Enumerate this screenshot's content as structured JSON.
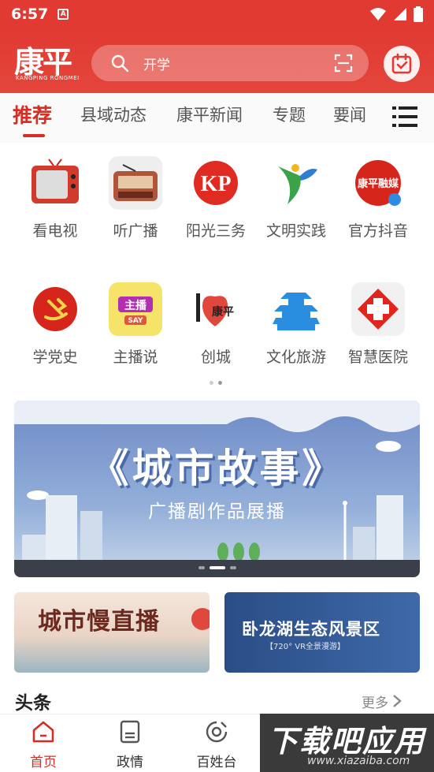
{
  "status": {
    "time": "6:57",
    "notif_letter": "A"
  },
  "header": {
    "logo_text": "康平",
    "logo_subtext": "KANGPING RONGMEI",
    "search_placeholder": "开学"
  },
  "tabs": [
    {
      "label": "推荐",
      "active": true
    },
    {
      "label": "县域动态"
    },
    {
      "label": "康平新闻"
    },
    {
      "label": "专题"
    },
    {
      "label": "要闻"
    }
  ],
  "grid_row1": [
    {
      "label": "看电视",
      "icon": "tv-icon"
    },
    {
      "label": "听广播",
      "icon": "radio-icon"
    },
    {
      "label": "阳光三务",
      "icon": "kp-logo-icon"
    },
    {
      "label": "文明实践",
      "icon": "civilization-icon"
    },
    {
      "label": "官方抖音",
      "icon": "douyin-icon",
      "badge_text": "康平融媒"
    }
  ],
  "grid_row2": [
    {
      "label": "学党史",
      "icon": "party-emblem-icon"
    },
    {
      "label": "主播说",
      "icon": "anchor-say-icon",
      "badge_text": "主播",
      "badge_sub": "SAY"
    },
    {
      "label": "创城",
      "icon": "love-kangping-icon",
      "badge_text": "康平"
    },
    {
      "label": "文化旅游",
      "icon": "pavilion-icon"
    },
    {
      "label": "智慧医院",
      "icon": "hospital-cross-icon"
    }
  ],
  "banner": {
    "title": "《城市故事》",
    "subtitle": "广播剧作品展播"
  },
  "cards": [
    {
      "title": "城市慢直播"
    },
    {
      "title": "卧龙湖生态风景区",
      "subtitle": "【720° VR全景漫游】"
    }
  ],
  "section": {
    "title": "头条",
    "more": "更多"
  },
  "bottom_nav": [
    {
      "label": "首页",
      "icon": "home-icon",
      "active": true
    },
    {
      "label": "政情",
      "icon": "document-icon"
    },
    {
      "label": "百姓台",
      "icon": "report-icon"
    }
  ],
  "watermark": {
    "line1": "下载吧应用",
    "line2": "www.xiazaiba.com"
  },
  "colors": {
    "brand": "#e03a32",
    "active": "#d32f25"
  }
}
